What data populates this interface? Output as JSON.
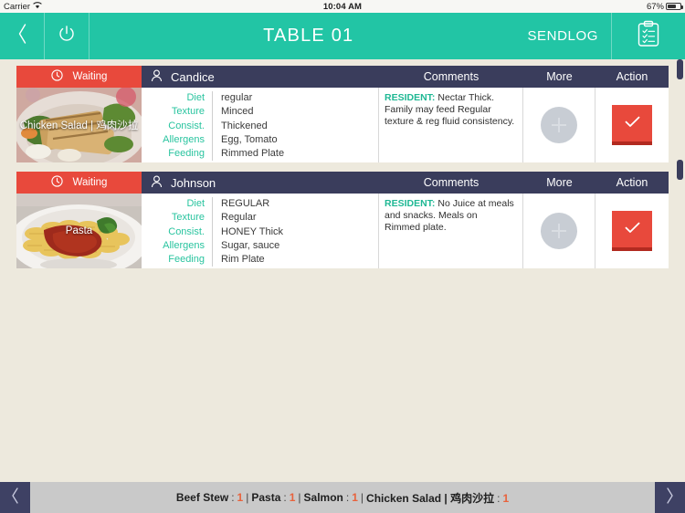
{
  "status_bar": {
    "carrier": "Carrier",
    "wifi_icon": "wifi-icon",
    "time": "10:04 AM",
    "battery_pct": "67%",
    "battery_icon": "battery-icon"
  },
  "header": {
    "back_icon": "chevron-left-icon",
    "power_icon": "power-icon",
    "title": "TABLE 01",
    "sendlog_label": "SENDLOG",
    "clipboard_icon": "clipboard-checklist-icon",
    "accent_color": "#22C5A5"
  },
  "columns": {
    "status": "Waiting",
    "comments": "Comments",
    "more": "More",
    "action": "Action"
  },
  "orders": [
    {
      "status": "Waiting",
      "status_icon": "clock-icon",
      "status_color": "#E8493C",
      "guest_icon": "person-icon",
      "guest": "Candice",
      "dish": "Chicken Salad | 鸡肉沙拉",
      "diet_labels": {
        "diet": "Diet",
        "texture": "Texture",
        "consist": "Consist.",
        "allergens": "Allergens",
        "feeding": "Feeding"
      },
      "diet_values": {
        "diet": "regular",
        "texture": "Minced",
        "consist": "Thickened",
        "allergens": "Egg, Tomato",
        "feeding": "Rimmed Plate"
      },
      "comment_who": "RESIDENT:",
      "comment_text": " Nectar Thick. Family may feed Regular texture & reg fluid consistency.",
      "more_icon": "plus-circle-icon",
      "action_icon": "check-icon"
    },
    {
      "status": "Waiting",
      "status_icon": "clock-icon",
      "status_color": "#E8493C",
      "guest_icon": "person-icon",
      "guest": "Johnson",
      "dish": "Pasta",
      "diet_labels": {
        "diet": "Diet",
        "texture": "Texture",
        "consist": "Consist.",
        "allergens": "Allergens",
        "feeding": "Feeding"
      },
      "diet_values": {
        "diet": "REGULAR",
        "texture": "Regular",
        "consist": "HONEY Thick",
        "allergens": "Sugar, sauce",
        "feeding": "Rim Plate"
      },
      "comment_who": "RESIDENT:",
      "comment_text": " No Juice at meals and snacks. Meals on Rimmed plate.",
      "more_icon": "plus-circle-icon",
      "action_icon": "check-icon"
    }
  ],
  "footer": {
    "prev_icon": "chevron-left-icon",
    "next_icon": "chevron-right-icon",
    "count_color": "#E8623C",
    "tally": [
      {
        "name": "Beef Stew",
        "count": "1"
      },
      {
        "name": "Pasta",
        "count": "1"
      },
      {
        "name": "Salmon",
        "count": "1"
      },
      {
        "name": "Chicken Salad | 鸡肉沙拉",
        "count": "1"
      }
    ]
  }
}
